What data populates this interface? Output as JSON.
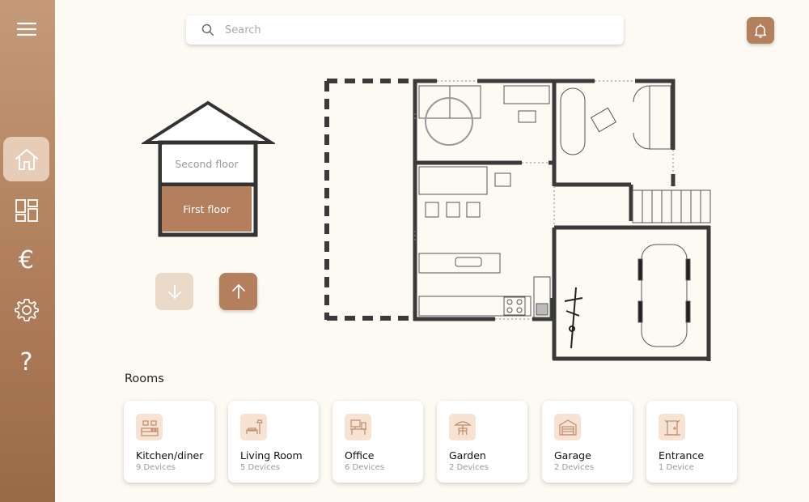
{
  "search": {
    "placeholder": "Search"
  },
  "icons": {
    "menu": "menu-icon",
    "home": "home-icon",
    "dashboard": "dashboard-icon",
    "euro": "euro-icon",
    "settings": "gear-icon",
    "help": "help-icon",
    "bell": "bell-icon"
  },
  "sidebar": {
    "euro_glyph": "€",
    "help_glyph": "?"
  },
  "floors": {
    "second": "Second floor",
    "first": "First floor",
    "selected": "First floor"
  },
  "colors": {
    "accent": "#b47f5c",
    "accent_light": "#ead8c9",
    "background": "#fdfaf3",
    "wall": "#3a3a3a"
  },
  "rooms": {
    "title": "Rooms",
    "items": [
      {
        "name": "Kitchen/diner",
        "devices": "9 Devices"
      },
      {
        "name": "Living Room",
        "devices": "5 Devices"
      },
      {
        "name": "Office",
        "devices": "6 Devices"
      },
      {
        "name": "Garden",
        "devices": "2 Devices"
      },
      {
        "name": "Garage",
        "devices": "2 Devices"
      },
      {
        "name": "Entrance",
        "devices": "1 Device"
      }
    ]
  }
}
